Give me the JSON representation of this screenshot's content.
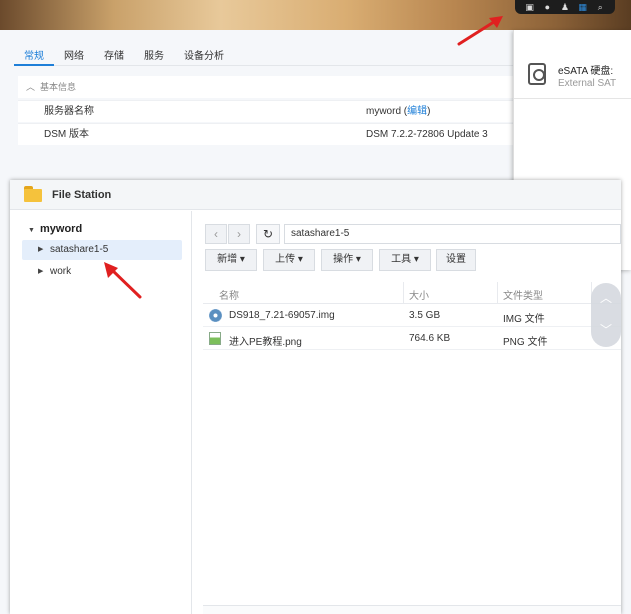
{
  "control_panel": {
    "tabs": [
      "常规",
      "网络",
      "存储",
      "服务",
      "设备分析"
    ],
    "active_tab": 0,
    "section_label": "基本信息",
    "rows": [
      {
        "label": "服务器名称",
        "value": "myword",
        "link": "编辑"
      },
      {
        "label": "DSM 版本",
        "value": "DSM 7.2.2-72806 Update 3"
      }
    ]
  },
  "notification": {
    "title": "eSATA 硬盘:",
    "subtitle": "External SAT"
  },
  "file_station": {
    "title": "File Station",
    "tree": {
      "root": "myword",
      "items": [
        "satashare1-5",
        "work"
      ]
    },
    "path": "satashare1-5",
    "toolbar": {
      "new": "新增",
      "upload": "上传",
      "action": "操作",
      "tools": "工具",
      "settings": "设置"
    },
    "columns": {
      "name": "名称",
      "size": "大小",
      "type": "文件类型"
    },
    "files": [
      {
        "name": "DS918_7.21-69057.img",
        "size": "3.5 GB",
        "type": "IMG 文件"
      },
      {
        "name": "进入PE教程.png",
        "size": "764.6 KB",
        "type": "PNG 文件"
      }
    ]
  },
  "colors": {
    "accent": "#1e7fd8",
    "annotation": "#e02020",
    "folder": "#f5c23c"
  }
}
